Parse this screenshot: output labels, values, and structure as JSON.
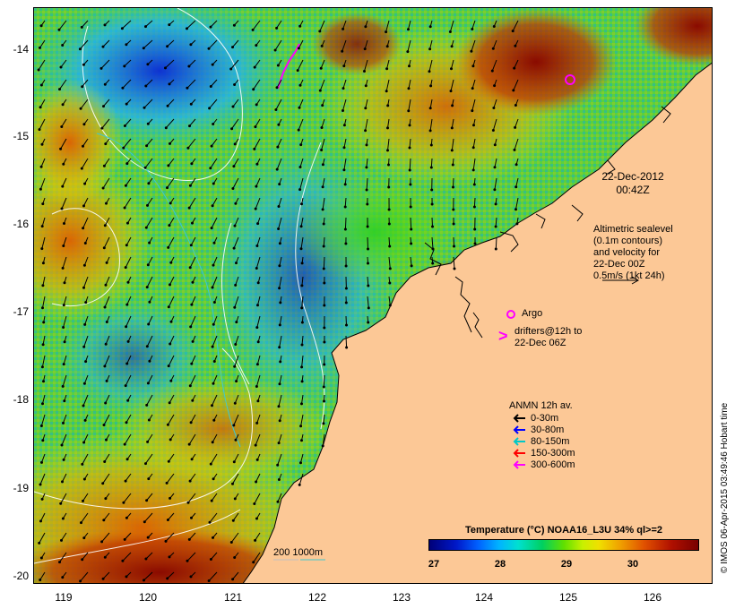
{
  "map": {
    "y_ticks": [
      "-14",
      "-15",
      "-16",
      "-17",
      "-18",
      "-19",
      "-20"
    ],
    "x_ticks": [
      "119",
      "120",
      "121",
      "122",
      "123",
      "124",
      "125",
      "126"
    ],
    "lat_range": [
      -20.1,
      -13.55
    ],
    "lon_range": [
      118.65,
      126.7
    ]
  },
  "annotations": {
    "date_line1": "22-Dec-2012",
    "date_line2": "00:42Z",
    "altimetry_lines": [
      "Altimetric sealevel",
      "(0.1m contours)",
      "and velocity for",
      "22-Dec 00Z",
      "0.5m/s (1kt 24h)"
    ],
    "argo_label": "Argo",
    "drifter_symbol": ">",
    "drifters_line1": "drifters@12h to",
    "drifters_line2": "22-Dec 06Z",
    "depth_scale": "200  1000m"
  },
  "legend": {
    "title": "ANMN 12h av.",
    "items": [
      {
        "label": "0-30m",
        "color": "#000000"
      },
      {
        "label": "30-80m",
        "color": "#0000ff"
      },
      {
        "label": "80-150m",
        "color": "#00c8c8"
      },
      {
        "label": "150-300m",
        "color": "#ff0000"
      },
      {
        "label": "300-600m",
        "color": "#ff00ff"
      }
    ]
  },
  "colorbar": {
    "title": "Temperature (°C) NOAA16_L3U 34% ql>=2",
    "ticks": [
      "27",
      "28",
      "29",
      "30"
    ],
    "range": [
      26.6,
      30.7
    ]
  },
  "credit": "© IMOS 06-Apr-2015 03:49:46 Hobart time",
  "colors": {
    "land": "#fcc896",
    "sst_cold": "#000078",
    "sst_warm": "#780000",
    "argo": "#ff00ff"
  }
}
